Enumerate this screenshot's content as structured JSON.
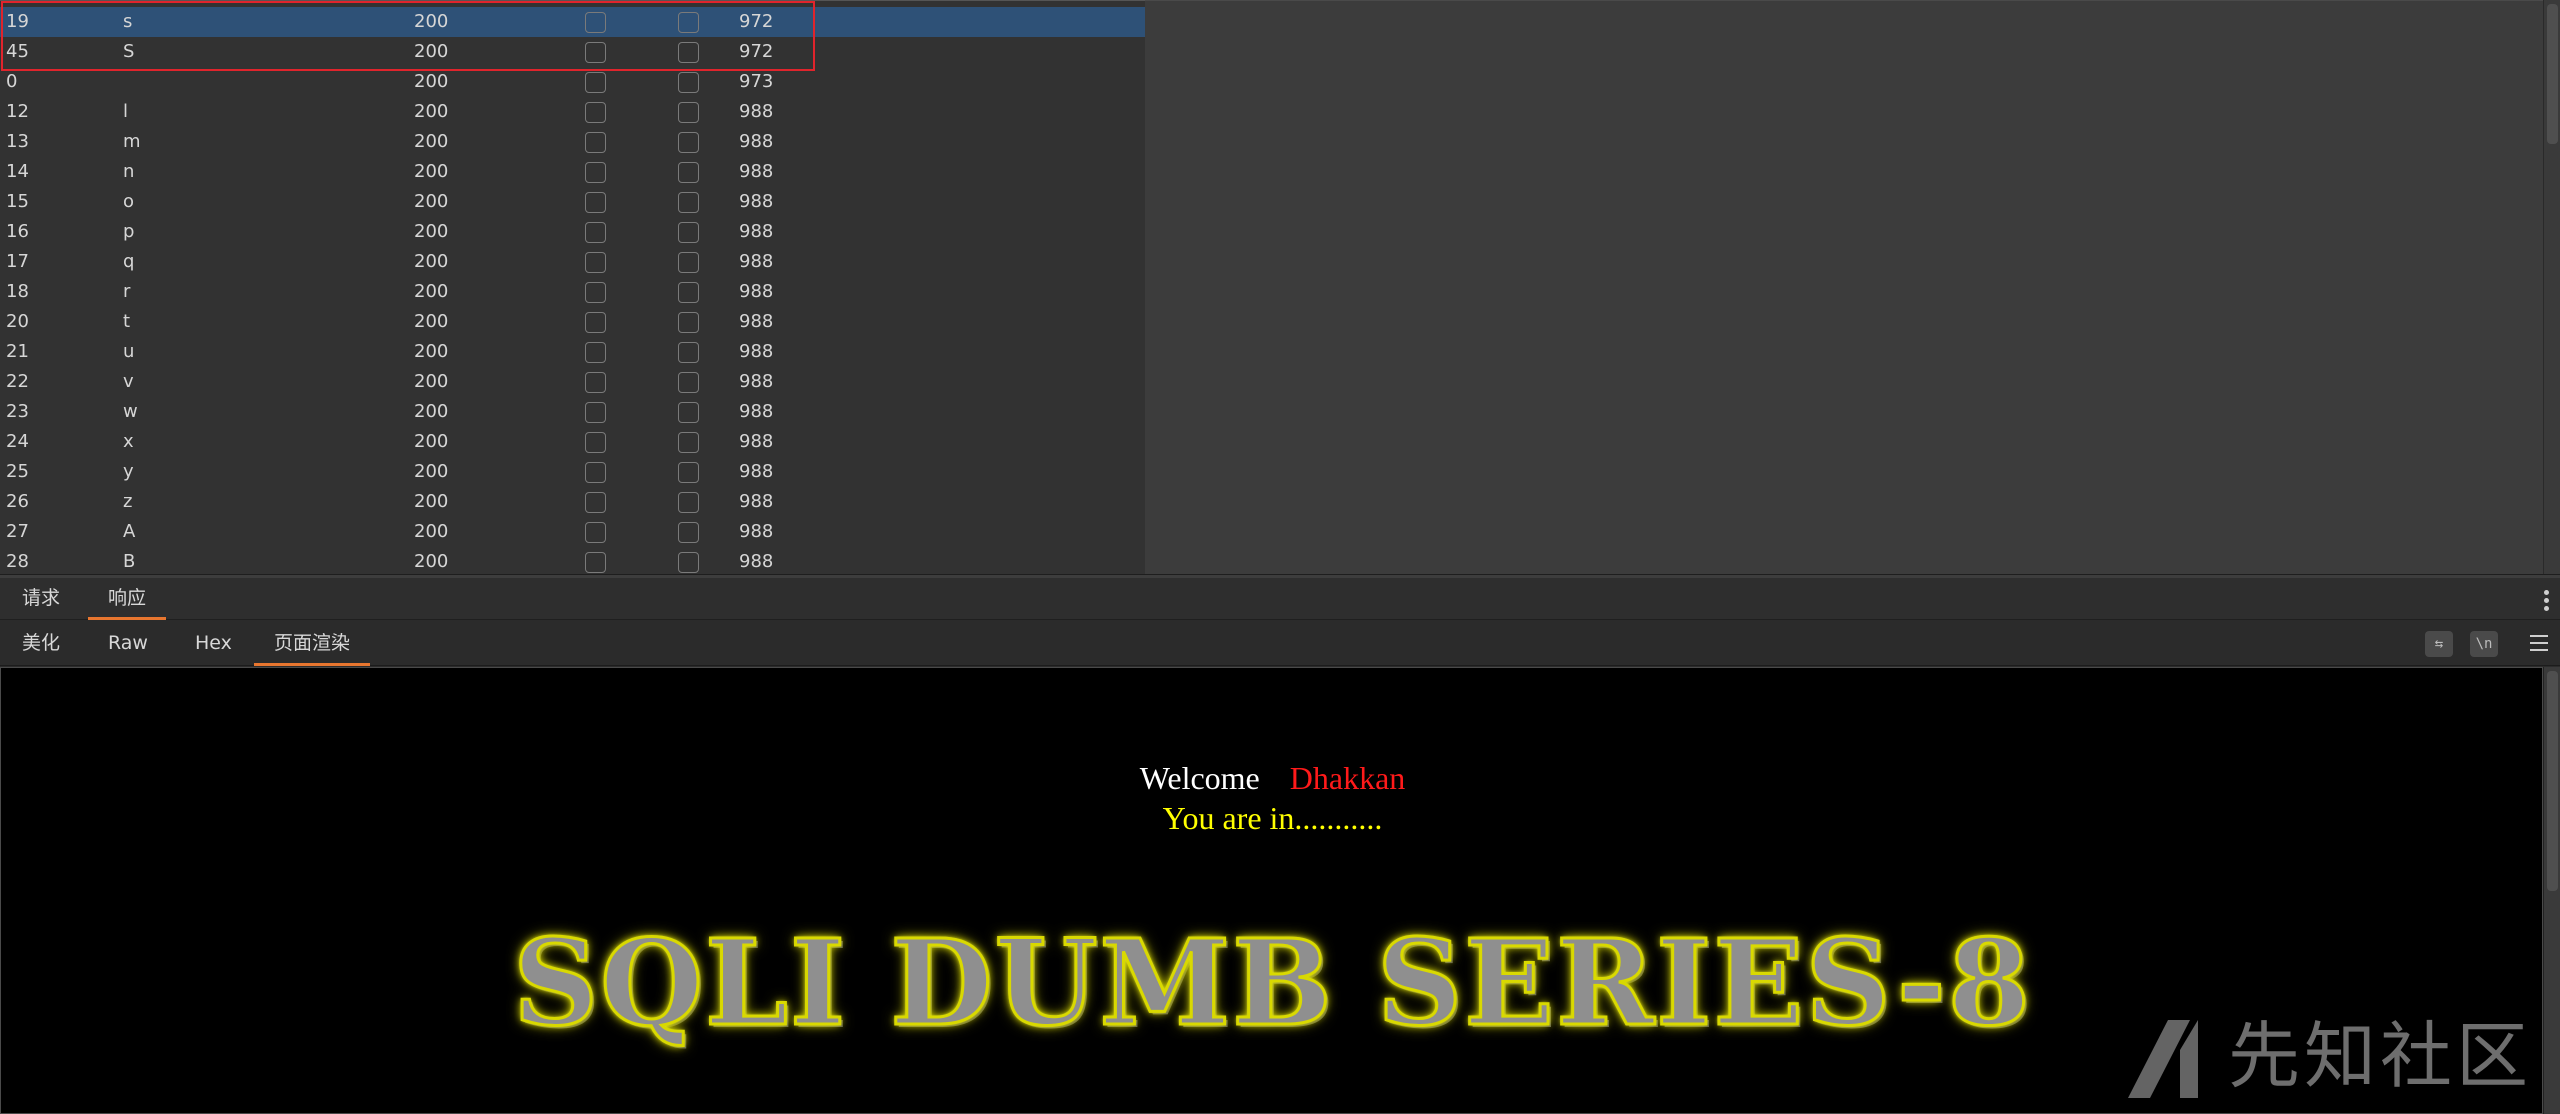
{
  "results": {
    "rows": [
      {
        "idx": "19",
        "payload": "s",
        "status": "200",
        "length": "972",
        "selected": true
      },
      {
        "idx": "45",
        "payload": "S",
        "status": "200",
        "length": "972"
      },
      {
        "idx": "0",
        "payload": "",
        "status": "200",
        "length": "973"
      },
      {
        "idx": "12",
        "payload": "l",
        "status": "200",
        "length": "988"
      },
      {
        "idx": "13",
        "payload": "m",
        "status": "200",
        "length": "988"
      },
      {
        "idx": "14",
        "payload": "n",
        "status": "200",
        "length": "988"
      },
      {
        "idx": "15",
        "payload": "o",
        "status": "200",
        "length": "988"
      },
      {
        "idx": "16",
        "payload": "p",
        "status": "200",
        "length": "988"
      },
      {
        "idx": "17",
        "payload": "q",
        "status": "200",
        "length": "988"
      },
      {
        "idx": "18",
        "payload": "r",
        "status": "200",
        "length": "988"
      },
      {
        "idx": "20",
        "payload": "t",
        "status": "200",
        "length": "988"
      },
      {
        "idx": "21",
        "payload": "u",
        "status": "200",
        "length": "988"
      },
      {
        "idx": "22",
        "payload": "v",
        "status": "200",
        "length": "988"
      },
      {
        "idx": "23",
        "payload": "w",
        "status": "200",
        "length": "988"
      },
      {
        "idx": "24",
        "payload": "x",
        "status": "200",
        "length": "988"
      },
      {
        "idx": "25",
        "payload": "y",
        "status": "200",
        "length": "988"
      },
      {
        "idx": "26",
        "payload": "z",
        "status": "200",
        "length": "988"
      },
      {
        "idx": "27",
        "payload": "A",
        "status": "200",
        "length": "988"
      },
      {
        "idx": "28",
        "payload": "B",
        "status": "200",
        "length": "988"
      }
    ]
  },
  "message_tabs": {
    "request": "请求",
    "response": "响应"
  },
  "view_tabs": {
    "pretty": "美化",
    "raw": "Raw",
    "hex": "Hex",
    "render": "页面渲染"
  },
  "toolbar": {
    "wrap_icon": "wrap-icon",
    "newline_label": "\\n",
    "menu_icon": "hamburger-icon"
  },
  "rendered_page": {
    "welcome": "Welcome",
    "name": "Dhakkan",
    "message": "You are in...........",
    "banner": "SQLI DUMB SERIES-8"
  },
  "watermark": {
    "text": "先知社区"
  },
  "colors": {
    "selected_row": "#2e5177",
    "highlight_box": "#e0242c",
    "tab_accent": "#e8762f",
    "welcome_white": "#ffffff",
    "name_red": "#ff1a1a",
    "message_yellow": "#ffff00"
  }
}
